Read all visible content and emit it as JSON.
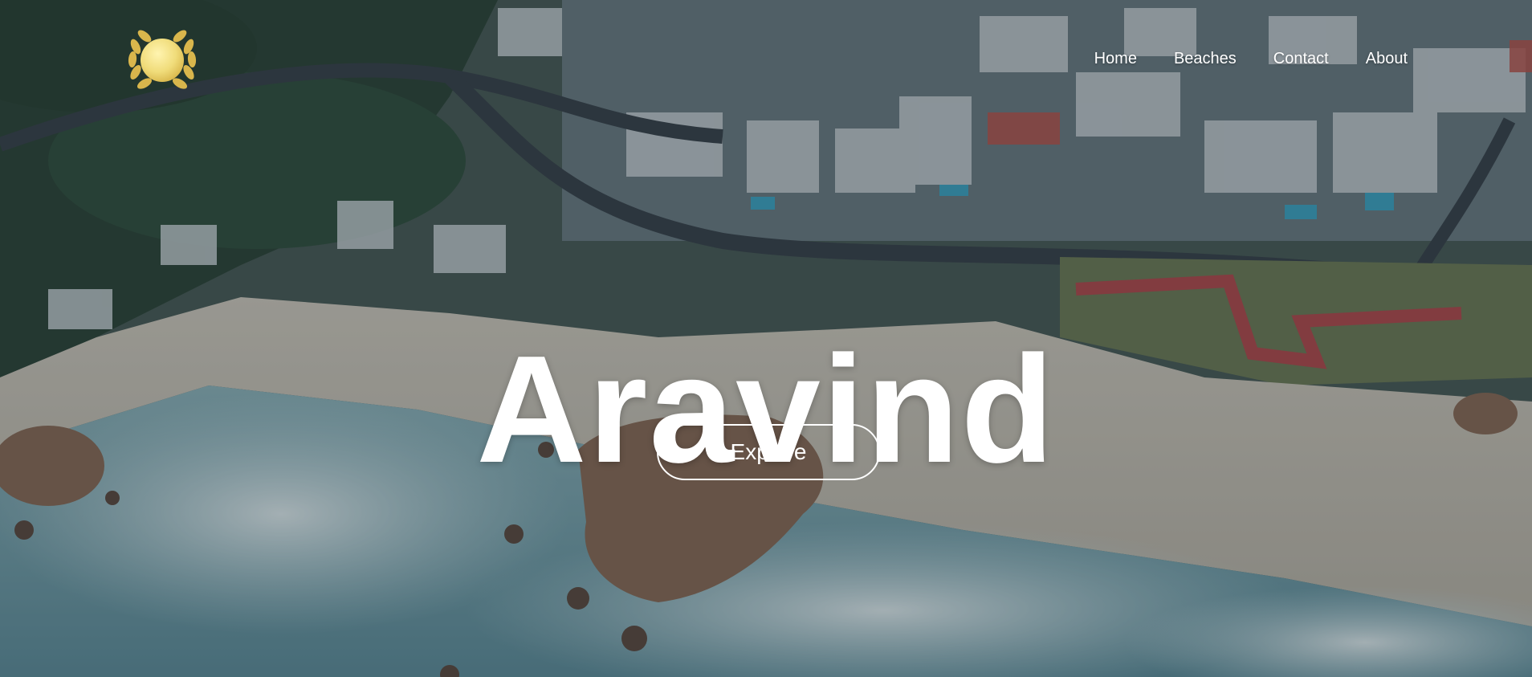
{
  "brand": {
    "logo_icon": "laurel-wreath-gold-coin-icon",
    "accent_gold": "#e8cf6a"
  },
  "nav": {
    "items": [
      {
        "label": "Home"
      },
      {
        "label": "Beaches"
      },
      {
        "label": "Contact"
      },
      {
        "label": "About"
      }
    ]
  },
  "hero": {
    "title": "Aravind",
    "cta_label": "Explore",
    "background": "aerial-coastline-photo",
    "colors": {
      "ocean": "#6f9aa6",
      "foam": "#cfe0e3",
      "sand": "#c9c3b6",
      "road": "#3a4248",
      "vegetation": "#2d4a3a"
    }
  }
}
